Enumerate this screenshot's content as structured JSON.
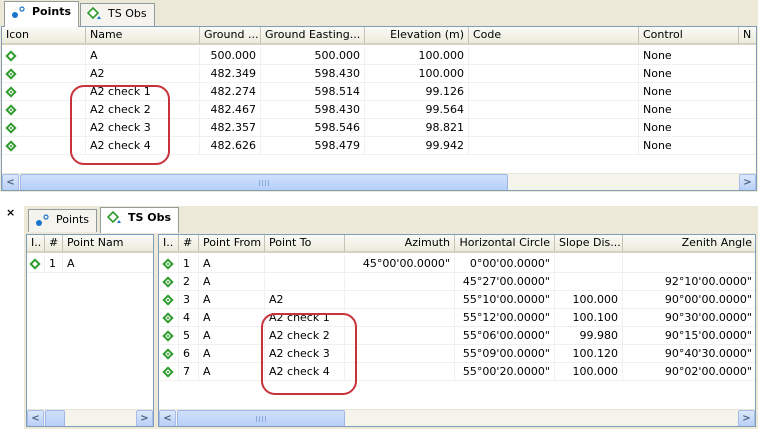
{
  "top_panel": {
    "tabs": [
      {
        "label": "Points",
        "active": true
      },
      {
        "label": "TS Obs",
        "active": false
      }
    ],
    "columns": [
      "Icon",
      "Name",
      "Ground ...",
      "Ground Easting...",
      "Elevation (m)",
      "Code",
      "Control",
      "N"
    ],
    "rows": [
      {
        "name": "A",
        "northing": "500.000",
        "easting": "500.000",
        "elevation": "100.000",
        "code": "",
        "control": "None"
      },
      {
        "name": "A2",
        "northing": "482.349",
        "easting": "598.430",
        "elevation": "100.000",
        "code": "",
        "control": "None"
      },
      {
        "name": "A2 check 1",
        "northing": "482.274",
        "easting": "598.514",
        "elevation": "99.126",
        "code": "",
        "control": "None"
      },
      {
        "name": "A2 check 2",
        "northing": "482.467",
        "easting": "598.430",
        "elevation": "99.564",
        "code": "",
        "control": "None"
      },
      {
        "name": "A2 check 3",
        "northing": "482.357",
        "easting": "598.546",
        "elevation": "98.821",
        "code": "",
        "control": "None"
      },
      {
        "name": "A2 check 4",
        "northing": "482.626",
        "easting": "598.479",
        "elevation": "99.942",
        "code": "",
        "control": "None"
      }
    ]
  },
  "bottom_panel": {
    "close_glyph": "×",
    "tabs": [
      {
        "label": "Points",
        "active": false
      },
      {
        "label": "TS Obs",
        "active": true
      }
    ],
    "left_grid": {
      "columns": [
        "I..",
        "#",
        "Point Nam"
      ],
      "rows": [
        {
          "index": "1",
          "point_name": "A"
        }
      ]
    },
    "right_grid": {
      "columns": [
        "I..",
        "#",
        "Point From",
        "Point To",
        "Azimuth",
        "Horizontal Circle",
        "Slope Dis...",
        "Zenith Angle"
      ],
      "rows": [
        {
          "index": "1",
          "from": "A",
          "to": "",
          "azimuth": "45°00'00.0000\"",
          "hcircle": "0°00'00.0000\"",
          "slope": "",
          "zenith": ""
        },
        {
          "index": "2",
          "from": "A",
          "to": "",
          "azimuth": "",
          "hcircle": "45°27'00.0000\"",
          "slope": "",
          "zenith": "92°10'00.0000\""
        },
        {
          "index": "3",
          "from": "A",
          "to": "A2",
          "azimuth": "",
          "hcircle": "55°10'00.0000\"",
          "slope": "100.000",
          "zenith": "90°00'00.0000\""
        },
        {
          "index": "4",
          "from": "A",
          "to": "A2 check 1",
          "azimuth": "",
          "hcircle": "55°12'00.0000\"",
          "slope": "100.100",
          "zenith": "90°30'00.0000\""
        },
        {
          "index": "5",
          "from": "A",
          "to": "A2 check 2",
          "azimuth": "",
          "hcircle": "55°06'00.0000\"",
          "slope": "99.980",
          "zenith": "90°15'00.0000\""
        },
        {
          "index": "6",
          "from": "A",
          "to": "A2 check 3",
          "azimuth": "",
          "hcircle": "55°09'00.0000\"",
          "slope": "100.120",
          "zenith": "90°40'30.0000\""
        },
        {
          "index": "7",
          "from": "A",
          "to": "A2 check 4",
          "azimuth": "",
          "hcircle": "55°00'20.0000\"",
          "slope": "100.000",
          "zenith": "90°02'00.0000\""
        }
      ]
    }
  },
  "scroll": {
    "left": "<",
    "right": ">"
  },
  "colors": {
    "accent_green": "#2e9b2e",
    "highlight_red": "#c8323a",
    "grid_border": "#7f9db9"
  }
}
